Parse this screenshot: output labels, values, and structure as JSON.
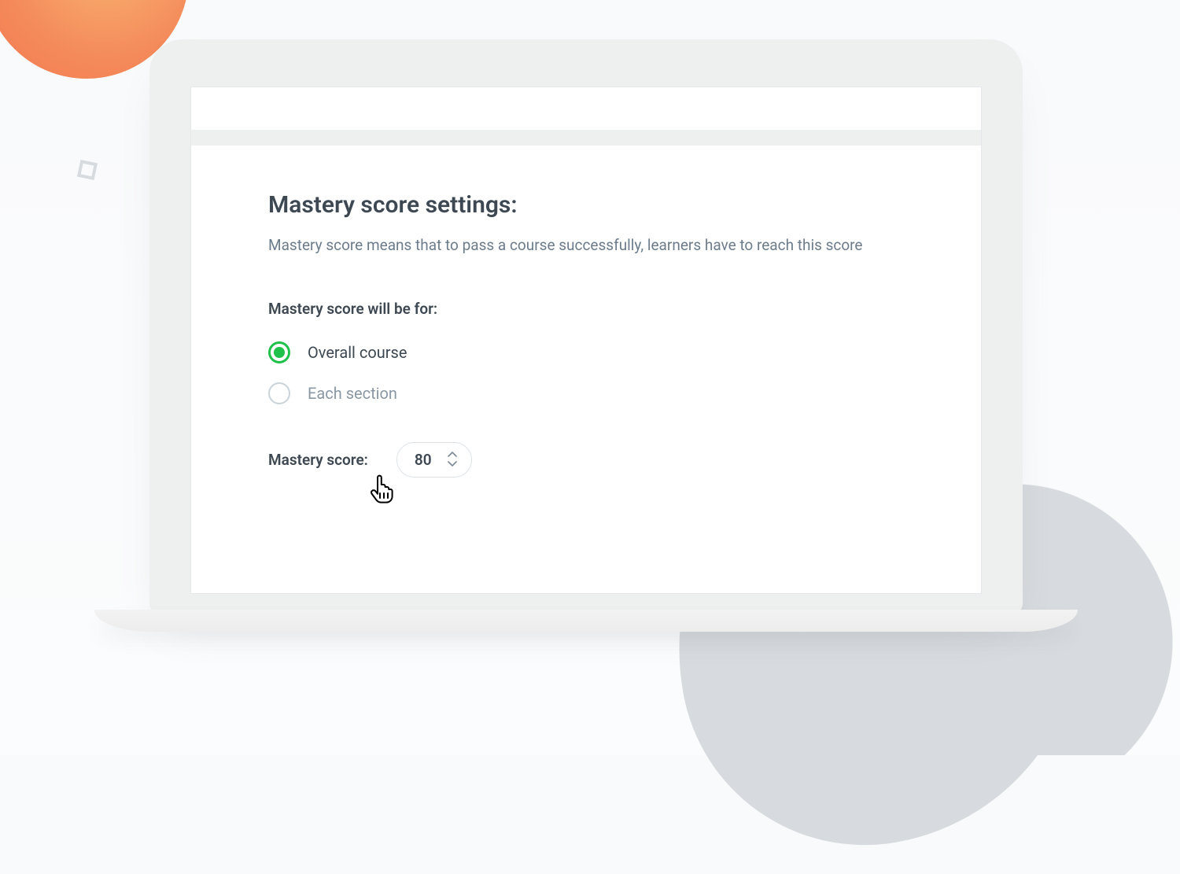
{
  "colors": {
    "accent_green": "#1fc14b",
    "text_dark": "#3d4852",
    "text_muted": "#6c7c8b"
  },
  "settings": {
    "title": "Mastery score settings:",
    "subtitle": "Mastery score means that to pass a course successfully, learners have to reach this score",
    "scope_label": "Mastery score will be for:",
    "options": [
      {
        "id": "overall",
        "label": "Overall course",
        "selected": true
      },
      {
        "id": "each-section",
        "label": "Each section",
        "selected": false
      }
    ],
    "score_label": "Mastery score:",
    "score_value": "80"
  }
}
